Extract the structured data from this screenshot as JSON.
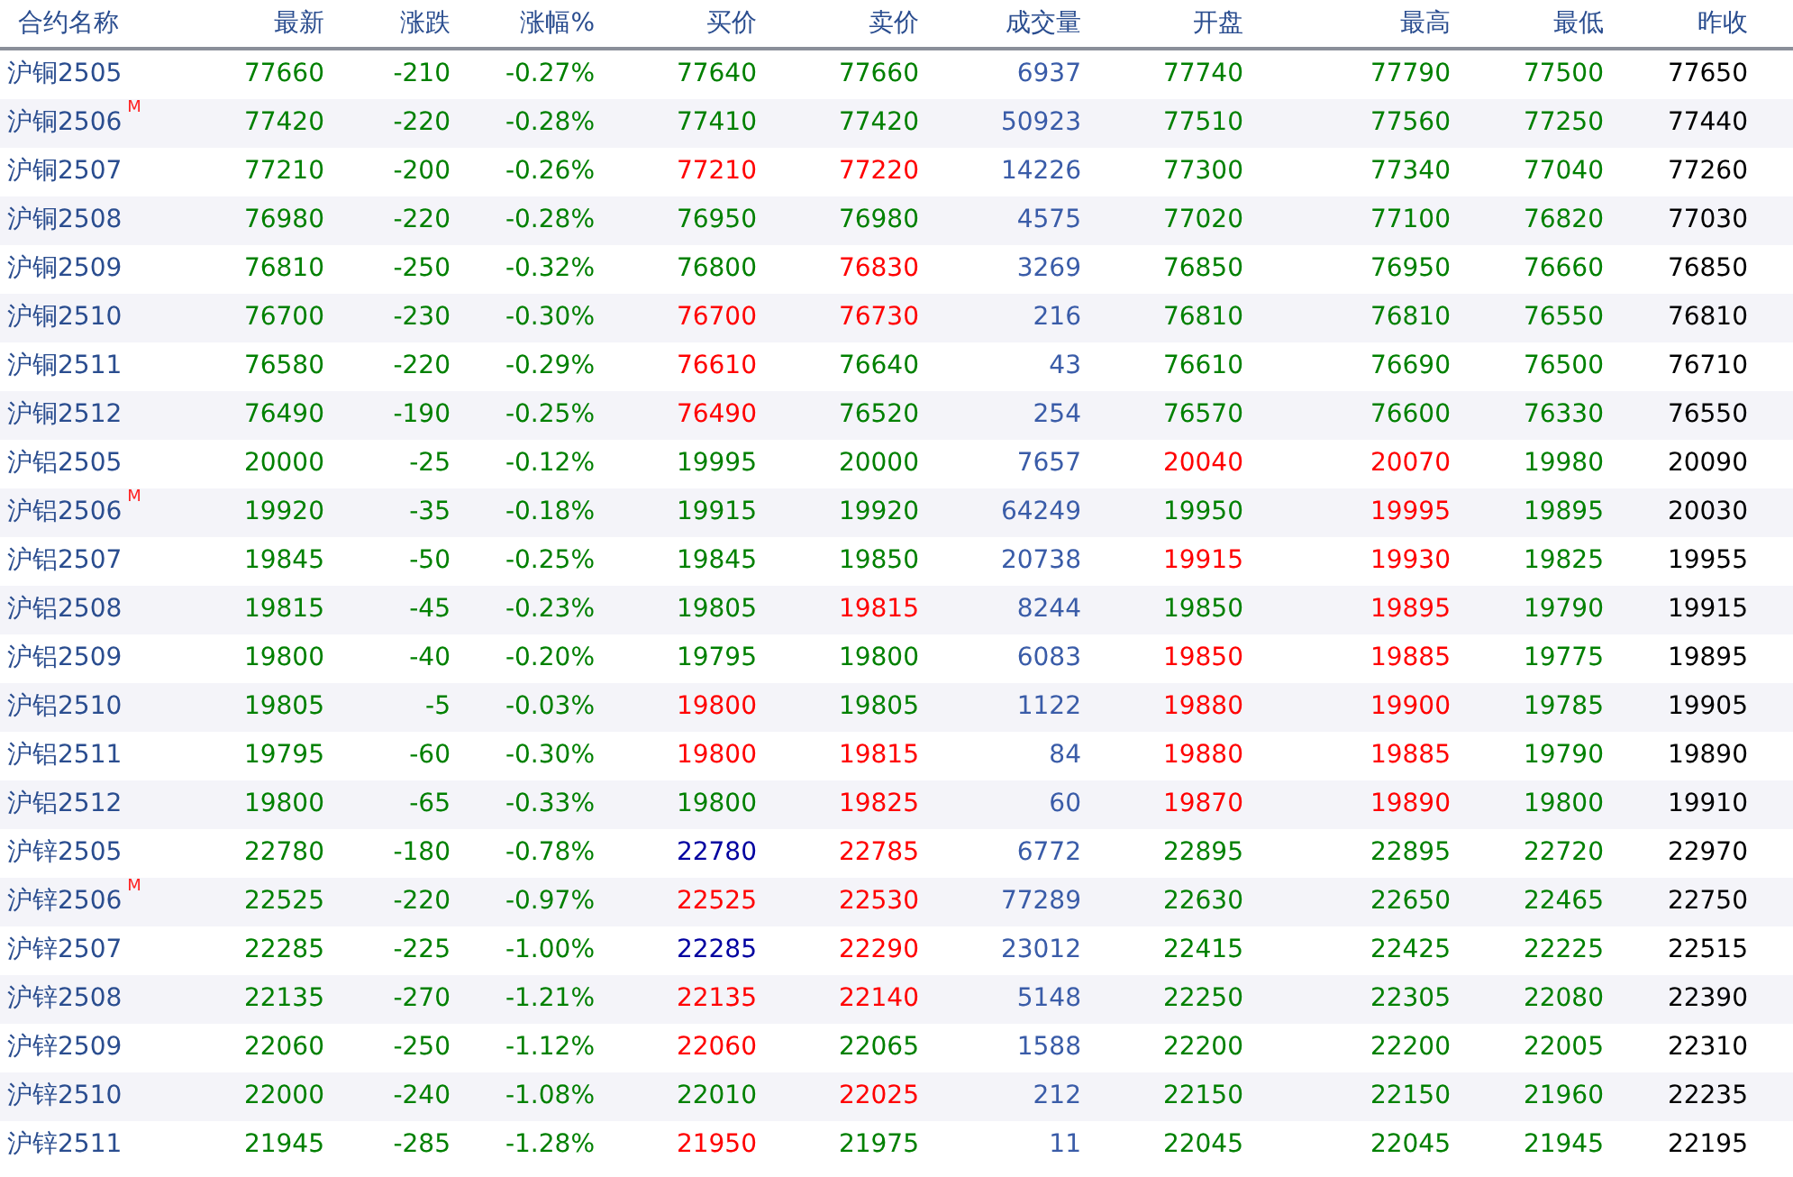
{
  "columns": [
    "合约名称",
    "最新",
    "涨跌",
    "涨幅%",
    "买价",
    "卖价",
    "成交量",
    "开盘",
    "最高",
    "最低",
    "昨收"
  ],
  "rows": [
    {
      "name": "沪铜2505",
      "cells": [
        {
          "text": "77660",
          "color": "#008000"
        },
        {
          "text": "-210",
          "color": "#008000"
        },
        {
          "text": "-0.27%",
          "color": "#008000"
        },
        {
          "text": "77640",
          "color": "#008000"
        },
        {
          "text": "77660",
          "color": "#008000"
        },
        {
          "text": "6937",
          "color": "#3a5ca8"
        },
        {
          "text": "77740",
          "color": "#008000"
        },
        {
          "text": "77790",
          "color": "#008000"
        },
        {
          "text": "77500",
          "color": "#008000"
        },
        {
          "text": "77650",
          "color": "#000000"
        }
      ]
    },
    {
      "name": "沪铜2506",
      "badge": "M",
      "cells": [
        {
          "text": "77420",
          "color": "#008000"
        },
        {
          "text": "-220",
          "color": "#008000"
        },
        {
          "text": "-0.28%",
          "color": "#008000"
        },
        {
          "text": "77410",
          "color": "#008000"
        },
        {
          "text": "77420",
          "color": "#008000"
        },
        {
          "text": "50923",
          "color": "#3a5ca8"
        },
        {
          "text": "77510",
          "color": "#008000"
        },
        {
          "text": "77560",
          "color": "#008000"
        },
        {
          "text": "77250",
          "color": "#008000"
        },
        {
          "text": "77440",
          "color": "#000000"
        }
      ]
    },
    {
      "name": "沪铜2507",
      "cells": [
        {
          "text": "77210",
          "color": "#008000"
        },
        {
          "text": "-200",
          "color": "#008000"
        },
        {
          "text": "-0.26%",
          "color": "#008000"
        },
        {
          "text": "77210",
          "color": "#ff0000"
        },
        {
          "text": "77220",
          "color": "#ff0000"
        },
        {
          "text": "14226",
          "color": "#3a5ca8"
        },
        {
          "text": "77300",
          "color": "#008000"
        },
        {
          "text": "77340",
          "color": "#008000"
        },
        {
          "text": "77040",
          "color": "#008000"
        },
        {
          "text": "77260",
          "color": "#000000"
        }
      ]
    },
    {
      "name": "沪铜2508",
      "cells": [
        {
          "text": "76980",
          "color": "#008000"
        },
        {
          "text": "-220",
          "color": "#008000"
        },
        {
          "text": "-0.28%",
          "color": "#008000"
        },
        {
          "text": "76950",
          "color": "#008000"
        },
        {
          "text": "76980",
          "color": "#008000"
        },
        {
          "text": "4575",
          "color": "#3a5ca8"
        },
        {
          "text": "77020",
          "color": "#008000"
        },
        {
          "text": "77100",
          "color": "#008000"
        },
        {
          "text": "76820",
          "color": "#008000"
        },
        {
          "text": "77030",
          "color": "#000000"
        }
      ]
    },
    {
      "name": "沪铜2509",
      "cells": [
        {
          "text": "76810",
          "color": "#008000"
        },
        {
          "text": "-250",
          "color": "#008000"
        },
        {
          "text": "-0.32%",
          "color": "#008000"
        },
        {
          "text": "76800",
          "color": "#008000"
        },
        {
          "text": "76830",
          "color": "#ff0000"
        },
        {
          "text": "3269",
          "color": "#3a5ca8"
        },
        {
          "text": "76850",
          "color": "#008000"
        },
        {
          "text": "76950",
          "color": "#008000"
        },
        {
          "text": "76660",
          "color": "#008000"
        },
        {
          "text": "76850",
          "color": "#000000"
        }
      ]
    },
    {
      "name": "沪铜2510",
      "cells": [
        {
          "text": "76700",
          "color": "#008000"
        },
        {
          "text": "-230",
          "color": "#008000"
        },
        {
          "text": "-0.30%",
          "color": "#008000"
        },
        {
          "text": "76700",
          "color": "#ff0000"
        },
        {
          "text": "76730",
          "color": "#ff0000"
        },
        {
          "text": "216",
          "color": "#3a5ca8"
        },
        {
          "text": "76810",
          "color": "#008000"
        },
        {
          "text": "76810",
          "color": "#008000"
        },
        {
          "text": "76550",
          "color": "#008000"
        },
        {
          "text": "76810",
          "color": "#000000"
        }
      ]
    },
    {
      "name": "沪铜2511",
      "cells": [
        {
          "text": "76580",
          "color": "#008000"
        },
        {
          "text": "-220",
          "color": "#008000"
        },
        {
          "text": "-0.29%",
          "color": "#008000"
        },
        {
          "text": "76610",
          "color": "#ff0000"
        },
        {
          "text": "76640",
          "color": "#008000"
        },
        {
          "text": "43",
          "color": "#3a5ca8"
        },
        {
          "text": "76610",
          "color": "#008000"
        },
        {
          "text": "76690",
          "color": "#008000"
        },
        {
          "text": "76500",
          "color": "#008000"
        },
        {
          "text": "76710",
          "color": "#000000"
        }
      ]
    },
    {
      "name": "沪铜2512",
      "cells": [
        {
          "text": "76490",
          "color": "#008000"
        },
        {
          "text": "-190",
          "color": "#008000"
        },
        {
          "text": "-0.25%",
          "color": "#008000"
        },
        {
          "text": "76490",
          "color": "#ff0000"
        },
        {
          "text": "76520",
          "color": "#008000"
        },
        {
          "text": "254",
          "color": "#3a5ca8"
        },
        {
          "text": "76570",
          "color": "#008000"
        },
        {
          "text": "76600",
          "color": "#008000"
        },
        {
          "text": "76330",
          "color": "#008000"
        },
        {
          "text": "76550",
          "color": "#000000"
        }
      ]
    },
    {
      "name": "沪铝2505",
      "cells": [
        {
          "text": "20000",
          "color": "#008000"
        },
        {
          "text": "-25",
          "color": "#008000"
        },
        {
          "text": "-0.12%",
          "color": "#008000"
        },
        {
          "text": "19995",
          "color": "#008000"
        },
        {
          "text": "20000",
          "color": "#008000"
        },
        {
          "text": "7657",
          "color": "#3a5ca8"
        },
        {
          "text": "20040",
          "color": "#ff0000"
        },
        {
          "text": "20070",
          "color": "#ff0000"
        },
        {
          "text": "19980",
          "color": "#008000"
        },
        {
          "text": "20090",
          "color": "#000000"
        }
      ]
    },
    {
      "name": "沪铝2506",
      "badge": "M",
      "cells": [
        {
          "text": "19920",
          "color": "#008000"
        },
        {
          "text": "-35",
          "color": "#008000"
        },
        {
          "text": "-0.18%",
          "color": "#008000"
        },
        {
          "text": "19915",
          "color": "#008000"
        },
        {
          "text": "19920",
          "color": "#008000"
        },
        {
          "text": "64249",
          "color": "#3a5ca8"
        },
        {
          "text": "19950",
          "color": "#008000"
        },
        {
          "text": "19995",
          "color": "#ff0000"
        },
        {
          "text": "19895",
          "color": "#008000"
        },
        {
          "text": "20030",
          "color": "#000000"
        }
      ]
    },
    {
      "name": "沪铝2507",
      "cells": [
        {
          "text": "19845",
          "color": "#008000"
        },
        {
          "text": "-50",
          "color": "#008000"
        },
        {
          "text": "-0.25%",
          "color": "#008000"
        },
        {
          "text": "19845",
          "color": "#008000"
        },
        {
          "text": "19850",
          "color": "#008000"
        },
        {
          "text": "20738",
          "color": "#3a5ca8"
        },
        {
          "text": "19915",
          "color": "#ff0000"
        },
        {
          "text": "19930",
          "color": "#ff0000"
        },
        {
          "text": "19825",
          "color": "#008000"
        },
        {
          "text": "19955",
          "color": "#000000"
        }
      ]
    },
    {
      "name": "沪铝2508",
      "cells": [
        {
          "text": "19815",
          "color": "#008000"
        },
        {
          "text": "-45",
          "color": "#008000"
        },
        {
          "text": "-0.23%",
          "color": "#008000"
        },
        {
          "text": "19805",
          "color": "#008000"
        },
        {
          "text": "19815",
          "color": "#ff0000"
        },
        {
          "text": "8244",
          "color": "#3a5ca8"
        },
        {
          "text": "19850",
          "color": "#008000"
        },
        {
          "text": "19895",
          "color": "#ff0000"
        },
        {
          "text": "19790",
          "color": "#008000"
        },
        {
          "text": "19915",
          "color": "#000000"
        }
      ]
    },
    {
      "name": "沪铝2509",
      "cells": [
        {
          "text": "19800",
          "color": "#008000"
        },
        {
          "text": "-40",
          "color": "#008000"
        },
        {
          "text": "-0.20%",
          "color": "#008000"
        },
        {
          "text": "19795",
          "color": "#008000"
        },
        {
          "text": "19800",
          "color": "#008000"
        },
        {
          "text": "6083",
          "color": "#3a5ca8"
        },
        {
          "text": "19850",
          "color": "#ff0000"
        },
        {
          "text": "19885",
          "color": "#ff0000"
        },
        {
          "text": "19775",
          "color": "#008000"
        },
        {
          "text": "19895",
          "color": "#000000"
        }
      ]
    },
    {
      "name": "沪铝2510",
      "cells": [
        {
          "text": "19805",
          "color": "#008000"
        },
        {
          "text": "-5",
          "color": "#008000"
        },
        {
          "text": "-0.03%",
          "color": "#008000"
        },
        {
          "text": "19800",
          "color": "#ff0000"
        },
        {
          "text": "19805",
          "color": "#008000"
        },
        {
          "text": "1122",
          "color": "#3a5ca8"
        },
        {
          "text": "19880",
          "color": "#ff0000"
        },
        {
          "text": "19900",
          "color": "#ff0000"
        },
        {
          "text": "19785",
          "color": "#008000"
        },
        {
          "text": "19905",
          "color": "#000000"
        }
      ]
    },
    {
      "name": "沪铝2511",
      "cells": [
        {
          "text": "19795",
          "color": "#008000"
        },
        {
          "text": "-60",
          "color": "#008000"
        },
        {
          "text": "-0.30%",
          "color": "#008000"
        },
        {
          "text": "19800",
          "color": "#ff0000"
        },
        {
          "text": "19815",
          "color": "#ff0000"
        },
        {
          "text": "84",
          "color": "#3a5ca8"
        },
        {
          "text": "19880",
          "color": "#ff0000"
        },
        {
          "text": "19885",
          "color": "#ff0000"
        },
        {
          "text": "19790",
          "color": "#008000"
        },
        {
          "text": "19890",
          "color": "#000000"
        }
      ]
    },
    {
      "name": "沪铝2512",
      "cells": [
        {
          "text": "19800",
          "color": "#008000"
        },
        {
          "text": "-65",
          "color": "#008000"
        },
        {
          "text": "-0.33%",
          "color": "#008000"
        },
        {
          "text": "19800",
          "color": "#008000"
        },
        {
          "text": "19825",
          "color": "#ff0000"
        },
        {
          "text": "60",
          "color": "#3a5ca8"
        },
        {
          "text": "19870",
          "color": "#ff0000"
        },
        {
          "text": "19890",
          "color": "#ff0000"
        },
        {
          "text": "19800",
          "color": "#008000"
        },
        {
          "text": "19910",
          "color": "#000000"
        }
      ]
    },
    {
      "name": "沪锌2505",
      "cells": [
        {
          "text": "22780",
          "color": "#008000"
        },
        {
          "text": "-180",
          "color": "#008000"
        },
        {
          "text": "-0.78%",
          "color": "#008000"
        },
        {
          "text": "22780",
          "color": "#0000a0"
        },
        {
          "text": "22785",
          "color": "#ff0000"
        },
        {
          "text": "6772",
          "color": "#3a5ca8"
        },
        {
          "text": "22895",
          "color": "#008000"
        },
        {
          "text": "22895",
          "color": "#008000"
        },
        {
          "text": "22720",
          "color": "#008000"
        },
        {
          "text": "22970",
          "color": "#000000"
        }
      ]
    },
    {
      "name": "沪锌2506",
      "badge": "M",
      "cells": [
        {
          "text": "22525",
          "color": "#008000"
        },
        {
          "text": "-220",
          "color": "#008000"
        },
        {
          "text": "-0.97%",
          "color": "#008000"
        },
        {
          "text": "22525",
          "color": "#ff0000"
        },
        {
          "text": "22530",
          "color": "#ff0000"
        },
        {
          "text": "77289",
          "color": "#3a5ca8"
        },
        {
          "text": "22630",
          "color": "#008000"
        },
        {
          "text": "22650",
          "color": "#008000"
        },
        {
          "text": "22465",
          "color": "#008000"
        },
        {
          "text": "22750",
          "color": "#000000"
        }
      ]
    },
    {
      "name": "沪锌2507",
      "cells": [
        {
          "text": "22285",
          "color": "#008000"
        },
        {
          "text": "-225",
          "color": "#008000"
        },
        {
          "text": "-1.00%",
          "color": "#008000"
        },
        {
          "text": "22285",
          "color": "#0000a0"
        },
        {
          "text": "22290",
          "color": "#ff0000"
        },
        {
          "text": "23012",
          "color": "#3a5ca8"
        },
        {
          "text": "22415",
          "color": "#008000"
        },
        {
          "text": "22425",
          "color": "#008000"
        },
        {
          "text": "22225",
          "color": "#008000"
        },
        {
          "text": "22515",
          "color": "#000000"
        }
      ]
    },
    {
      "name": "沪锌2508",
      "cells": [
        {
          "text": "22135",
          "color": "#008000"
        },
        {
          "text": "-270",
          "color": "#008000"
        },
        {
          "text": "-1.21%",
          "color": "#008000"
        },
        {
          "text": "22135",
          "color": "#ff0000"
        },
        {
          "text": "22140",
          "color": "#ff0000"
        },
        {
          "text": "5148",
          "color": "#3a5ca8"
        },
        {
          "text": "22250",
          "color": "#008000"
        },
        {
          "text": "22305",
          "color": "#008000"
        },
        {
          "text": "22080",
          "color": "#008000"
        },
        {
          "text": "22390",
          "color": "#000000"
        }
      ]
    },
    {
      "name": "沪锌2509",
      "cells": [
        {
          "text": "22060",
          "color": "#008000"
        },
        {
          "text": "-250",
          "color": "#008000"
        },
        {
          "text": "-1.12%",
          "color": "#008000"
        },
        {
          "text": "22060",
          "color": "#ff0000"
        },
        {
          "text": "22065",
          "color": "#008000"
        },
        {
          "text": "1588",
          "color": "#3a5ca8"
        },
        {
          "text": "22200",
          "color": "#008000"
        },
        {
          "text": "22200",
          "color": "#008000"
        },
        {
          "text": "22005",
          "color": "#008000"
        },
        {
          "text": "22310",
          "color": "#000000"
        }
      ]
    },
    {
      "name": "沪锌2510",
      "cells": [
        {
          "text": "22000",
          "color": "#008000"
        },
        {
          "text": "-240",
          "color": "#008000"
        },
        {
          "text": "-1.08%",
          "color": "#008000"
        },
        {
          "text": "22010",
          "color": "#008000"
        },
        {
          "text": "22025",
          "color": "#ff0000"
        },
        {
          "text": "212",
          "color": "#3a5ca8"
        },
        {
          "text": "22150",
          "color": "#008000"
        },
        {
          "text": "22150",
          "color": "#008000"
        },
        {
          "text": "21960",
          "color": "#008000"
        },
        {
          "text": "22235",
          "color": "#000000"
        }
      ]
    },
    {
      "name": "沪锌2511",
      "cells": [
        {
          "text": "21945",
          "color": "#008000"
        },
        {
          "text": "-285",
          "color": "#008000"
        },
        {
          "text": "-1.28%",
          "color": "#008000"
        },
        {
          "text": "21950",
          "color": "#ff0000"
        },
        {
          "text": "21975",
          "color": "#008000"
        },
        {
          "text": "11",
          "color": "#3a5ca8"
        },
        {
          "text": "22045",
          "color": "#008000"
        },
        {
          "text": "22045",
          "color": "#008000"
        },
        {
          "text": "21945",
          "color": "#008000"
        },
        {
          "text": "22195",
          "color": "#000000"
        }
      ]
    }
  ]
}
